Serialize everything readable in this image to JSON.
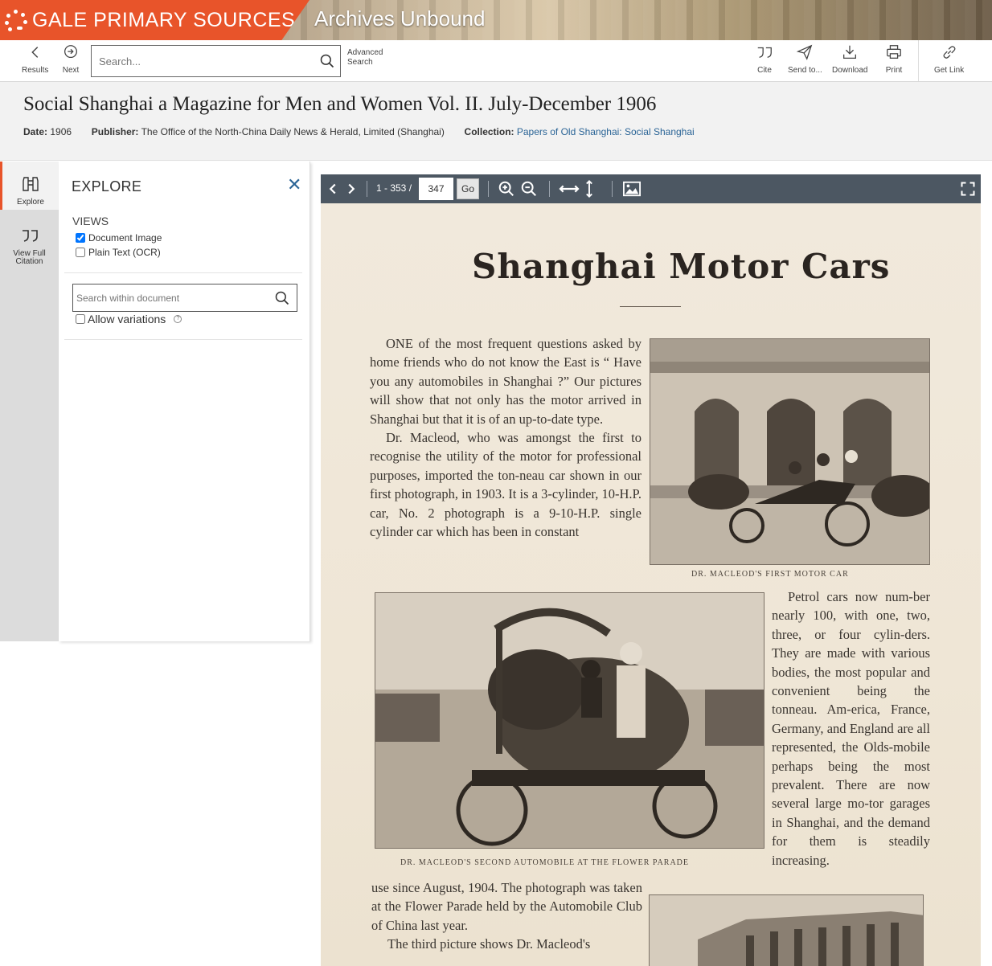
{
  "banner": {
    "brand": "GALE PRIMARY SOURCES",
    "product": "Archives Unbound",
    "brand_color": "#e8542a"
  },
  "toolbar": {
    "results_label": "Results",
    "next_label": "Next",
    "search_placeholder": "Search...",
    "advanced_label_1": "Advanced",
    "advanced_label_2": "Search",
    "cite_label": "Cite",
    "send_label": "Send to...",
    "download_label": "Download",
    "print_label": "Print",
    "link_label": "Get Link"
  },
  "document": {
    "title": "Social Shanghai a Magazine for Men and Women Vol. II. July-December 1906",
    "date_label": "Date:",
    "date_value": "1906",
    "publisher_label": "Publisher:",
    "publisher_value": "The Office of the North-China Daily News & Herald, Limited (Shanghai)",
    "collection_label": "Collection:",
    "collection_value": "Papers of Old Shanghai: Social Shanghai",
    "link_color": "#2a6496"
  },
  "rail": {
    "explore_label": "Explore",
    "citation_label_1": "View Full",
    "citation_label_2": "Citation"
  },
  "explore": {
    "title": "EXPLORE",
    "close": "✕",
    "views_label": "VIEWS",
    "view_document_image": "Document Image",
    "view_plain_text": "Plain Text (OCR)",
    "search_within_placeholder": "Search within document",
    "allow_variations": "Allow variations",
    "help": "?"
  },
  "viewer": {
    "page_range": "1 - 353 /",
    "page_value": "347",
    "go_label": "Go",
    "bar_color": "#4c5762"
  },
  "page": {
    "heading": "Shanghai Motor Cars",
    "col1": [
      "ONE of the most frequent questions asked by home friends who do not know the East is “ Have you any automobiles in Shanghai ?” Our pictures will show that not only has the motor arrived in Shanghai but that it is of an up-to-date type.",
      "Dr. Macleod, who was amongst the first to recognise the utility of the motor for professional purposes, imported the ton-neau car shown in our first photograph, in 1903. It is a 3-cylinder, 10-H.P. car, No. 2 photograph is a 9-10-H.P. single cylinder car which has been in constant"
    ],
    "col2": "Petrol cars now num-ber nearly 100, with one, two, three, or four cylin-ders. They are made with various bodies, the most popular and convenient being the tonneau. Am-erica, France, Germany, and England are all represented, the Olds-mobile perhaps being the most prevalent. There are now several large mo-tor garages in Shanghai, and the demand for them is steadily increasing.",
    "col3": [
      "use since August, 1904. The photograph was taken at the Flower Parade held by the Automobile Club of China last year.",
      "The third picture shows Dr. Macleod's"
    ],
    "caption1": "DR. MACLEOD'S FIRST MOTOR CAR",
    "caption2": "DR. MACLEOD'S SECOND AUTOMOBILE AT THE FLOWER PARADE"
  }
}
